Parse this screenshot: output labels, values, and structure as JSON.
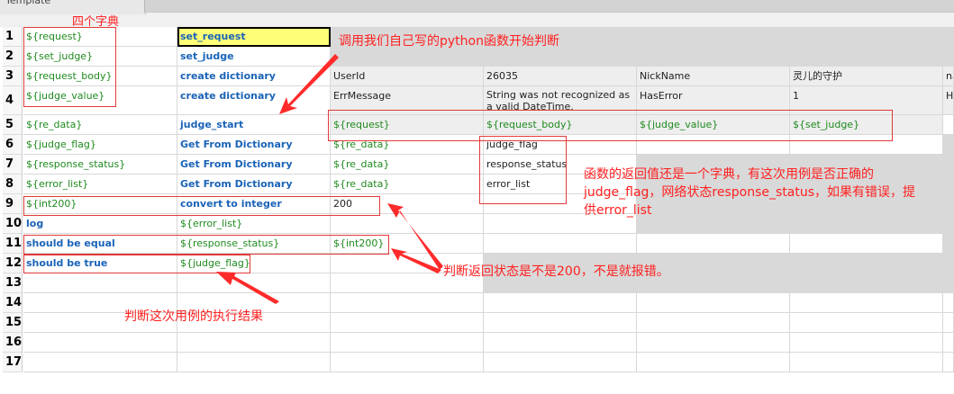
{
  "tab": {
    "label": "Template"
  },
  "rows": [
    {
      "n": "1",
      "cells": [
        "${request}",
        "set_request",
        "",
        "",
        "",
        "",
        ""
      ]
    },
    {
      "n": "2",
      "cells": [
        "${set_judge}",
        "set_judge",
        "",
        "",
        "",
        "",
        ""
      ]
    },
    {
      "n": "3",
      "cells": [
        "${request_body}",
        "create dictionary",
        "UserId",
        "26035",
        "NickName",
        "灵儿的守护",
        "na"
      ]
    },
    {
      "n": "4",
      "cells": [
        "${judge_value}",
        "create dictionary",
        "ErrMessage",
        "String was not recognized as a valid DateTime.",
        "HasError",
        "1",
        "HR"
      ]
    },
    {
      "n": "5",
      "cells": [
        "${re_data}",
        "judge_start",
        "${request}",
        "${request_body}",
        "${judge_value}",
        "${set_judge}",
        ""
      ]
    },
    {
      "n": "6",
      "cells": [
        "${judge_flag}",
        "Get From Dictionary",
        "${re_data}",
        "judge_flag",
        "",
        "",
        ""
      ]
    },
    {
      "n": "7",
      "cells": [
        "${response_status}",
        "Get From Dictionary",
        "${re_data}",
        "response_status",
        "",
        "",
        ""
      ]
    },
    {
      "n": "8",
      "cells": [
        "${error_list}",
        "Get From Dictionary",
        "${re_data}",
        "error_list",
        "",
        "",
        ""
      ]
    },
    {
      "n": "9",
      "cells": [
        "${int200}",
        "convert to integer",
        "200",
        "",
        "",
        "",
        ""
      ]
    },
    {
      "n": "10",
      "cells": [
        "log",
        "${error_list}",
        "",
        "",
        "",
        "",
        ""
      ]
    },
    {
      "n": "11",
      "cells": [
        "should be equal",
        "${response_status}",
        "${int200}",
        "",
        "",
        "",
        ""
      ]
    },
    {
      "n": "12",
      "cells": [
        "should be true",
        "${judge_flag}",
        "",
        "",
        "",
        "",
        ""
      ]
    },
    {
      "n": "13",
      "cells": [
        "",
        "",
        "",
        "",
        "",
        "",
        ""
      ]
    },
    {
      "n": "14",
      "cells": [
        "",
        "",
        "",
        "",
        "",
        "",
        ""
      ]
    },
    {
      "n": "15",
      "cells": [
        "",
        "",
        "",
        "",
        "",
        "",
        ""
      ]
    },
    {
      "n": "16",
      "cells": [
        "",
        "",
        "",
        "",
        "",
        "",
        ""
      ]
    },
    {
      "n": "17",
      "cells": [
        "",
        "",
        "",
        "",
        "",
        "",
        ""
      ]
    }
  ],
  "notes": {
    "four_dicts": "四个字典",
    "call_func": "调用我们自己写的python函数开始判断",
    "return_value_line1": "函数的返回值还是一个字典，有这次用例是否正确的",
    "return_value_line2": "judge_flag，网络状态response_status，如果有错误，提",
    "return_value_line3": "供error_list",
    "check_status": "判断返回状态是不是200，不是就报错。",
    "check_result": "判断这次用例的执行结果"
  },
  "colors": {
    "annotation": "#ff2020",
    "keyword": "#1a63b7",
    "variable": "#1f8a1f",
    "selected_cell": "#ffff77"
  }
}
